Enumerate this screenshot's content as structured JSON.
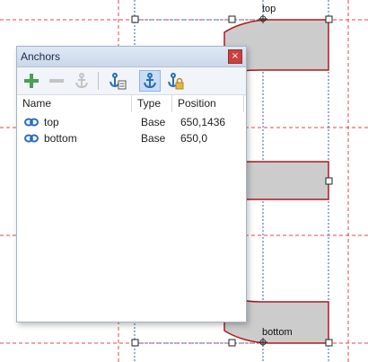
{
  "canvas": {
    "anchor_top_label": "top",
    "anchor_bottom_label": "bottom"
  },
  "panel": {
    "title": "Anchors",
    "close_glyph": "×",
    "toolbar": [
      {
        "name": "add-anchor-button",
        "icon": "plus-icon",
        "enabled": true
      },
      {
        "name": "remove-anchor-button",
        "icon": "minus-icon",
        "enabled": false
      },
      {
        "name": "anchor-tool-button",
        "icon": "anchor-icon",
        "enabled": false
      },
      {
        "name": "anchor-properties-button",
        "icon": "anchor-list-icon",
        "enabled": true
      },
      {
        "name": "show-anchors-button",
        "icon": "anchor-icon",
        "enabled": true,
        "active": true
      },
      {
        "name": "lock-anchors-button",
        "icon": "anchor-lock-icon",
        "enabled": true
      }
    ],
    "columns": [
      "Name",
      "Type",
      "Position"
    ],
    "rows": [
      {
        "name": "top",
        "type": "Base",
        "position": "650,1436"
      },
      {
        "name": "bottom",
        "type": "Base",
        "position": "650,0"
      }
    ]
  },
  "colors": {
    "guide_red": "#e0474c",
    "guide_blue": "#3f5fa8",
    "shape_fill": "#cccccc",
    "contour": "#b0181e",
    "anchor_blue": "#2a6fb6"
  }
}
